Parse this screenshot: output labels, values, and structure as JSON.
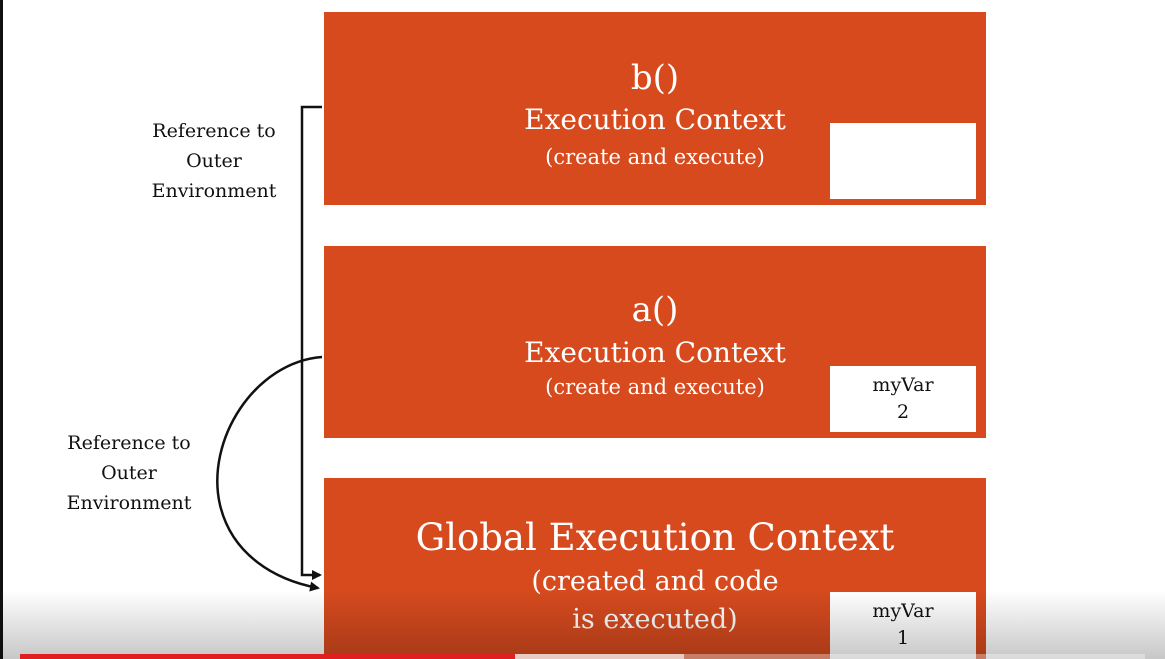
{
  "contexts": {
    "b": {
      "name": "b()",
      "title": "Execution Context",
      "subtitle": "(create and execute)",
      "var_name": "",
      "var_value": ""
    },
    "a": {
      "name": "a()",
      "title": "Execution Context",
      "subtitle": "(create and execute)",
      "var_name": "myVar",
      "var_value": "2"
    },
    "global": {
      "title": "Global Execution Context",
      "subtitle_line1": "(created and code",
      "subtitle_line2": "is executed)",
      "var_name": "myVar",
      "var_value": "1"
    }
  },
  "references": [
    {
      "line1": "Reference to",
      "line2": "Outer",
      "line3": "Environment"
    },
    {
      "line1": "Reference to",
      "line2": "Outer",
      "line3": "Environment"
    }
  ],
  "colors": {
    "context_box": "#d64a1e",
    "progress": "#e02020"
  },
  "video": {
    "progress_fraction": 0.44,
    "buffered_fraction": 0.59
  }
}
